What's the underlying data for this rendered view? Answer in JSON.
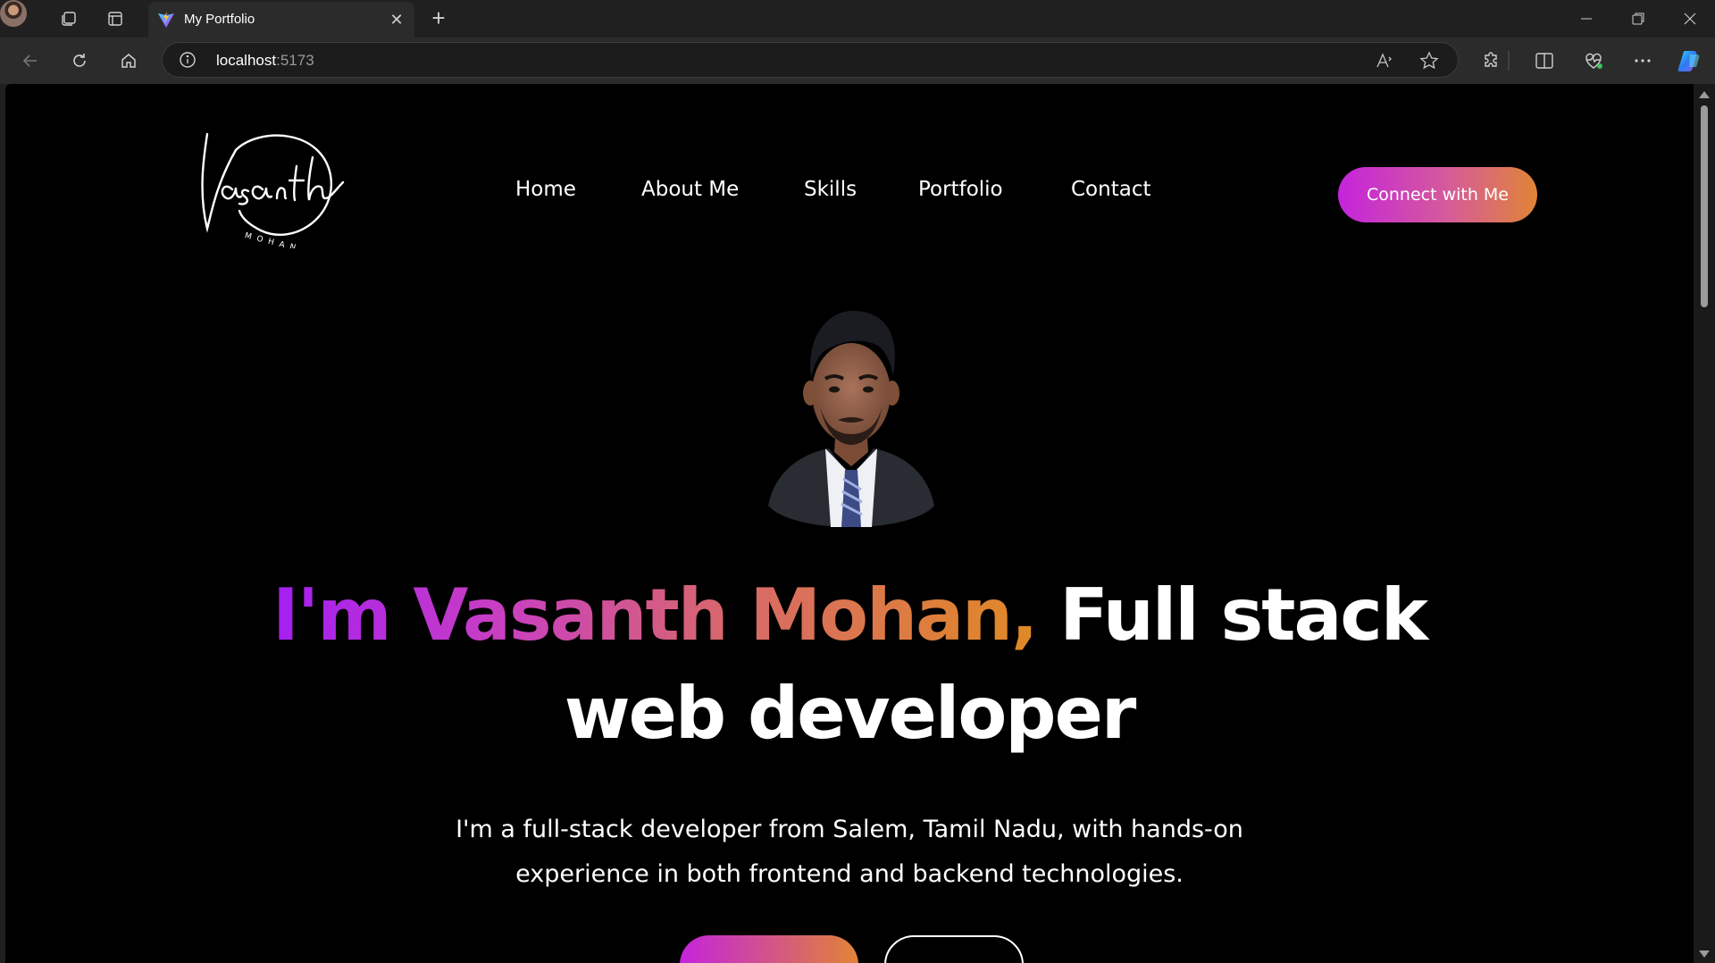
{
  "browser": {
    "tab_title": "My Portfolio",
    "address": {
      "host": "localhost",
      "port": ":5173"
    }
  },
  "colors": {
    "page_background": "#000000",
    "gradient_start": "#a41ef2",
    "gradient_mid": "#c93fc2",
    "gradient_end": "#e08a25",
    "text": "#ffffff"
  },
  "site": {
    "logo": {
      "name": "Vasanth",
      "subname": "MOHAN"
    },
    "nav": [
      {
        "label": "Home"
      },
      {
        "label": "About Me"
      },
      {
        "label": "Skills"
      },
      {
        "label": "Portfolio"
      },
      {
        "label": "Contact"
      }
    ],
    "cta_label": "Connect with Me"
  },
  "hero": {
    "headline_highlight": "I'm Vasanth Mohan,",
    "headline_rest_line1": "Full stack",
    "headline_line2": "web developer",
    "subtitle_line1": "I'm a full-stack developer from Salem, Tamil Nadu, with hands-on",
    "subtitle_line2": "experience in both frontend and backend technologies."
  }
}
